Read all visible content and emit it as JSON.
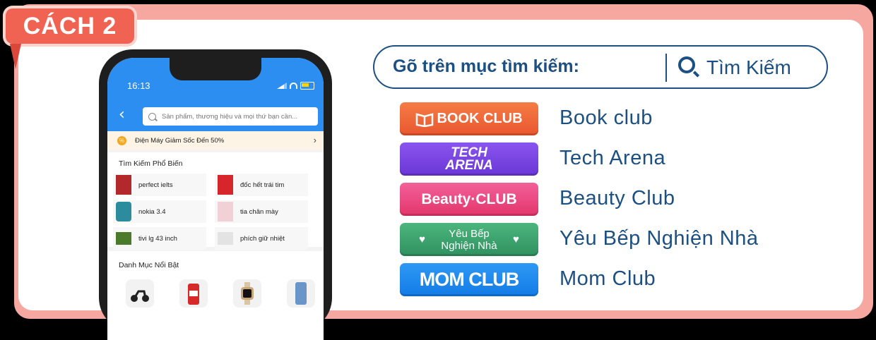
{
  "badge": {
    "label": "CÁCH 2"
  },
  "phone": {
    "time": "16:13",
    "search_placeholder": "Sản phẩm, thương hiệu và mọi thứ bạn cần...",
    "promo_text": "Điện Máy Giảm Sốc Đến 50%",
    "popular": {
      "title": "Tìm Kiếm Phổ Biến",
      "items": [
        "perfect ielts",
        "đốc hết trái tim",
        "nokia 3.4",
        "tia chân mày",
        "tivi lg 43 inch",
        "phích giữ nhiệt"
      ]
    },
    "categories": {
      "title": "Danh Mục Nổi Bật"
    }
  },
  "search_pill": {
    "label": "Gõ trên mục tìm kiếm:",
    "button_text": "Tìm Kiếm"
  },
  "clubs": [
    {
      "logo": "BOOK CLUB",
      "name": "Book club",
      "color": "#f26b3a"
    },
    {
      "logo": "TECH ARENA",
      "name": "Tech Arena",
      "color": "#7b47e0"
    },
    {
      "logo": "Beauty·CLUB",
      "name": "Beauty Club",
      "color": "#ef4b7e"
    },
    {
      "logo": "Yêu Bếp Nghiện Nhà",
      "name": "Yêu Bếp Nghiện Nhà",
      "color": "#3aa06b"
    },
    {
      "logo": "MOM CLUB",
      "name": "Mom Club",
      "color": "#1f8af0"
    }
  ]
}
